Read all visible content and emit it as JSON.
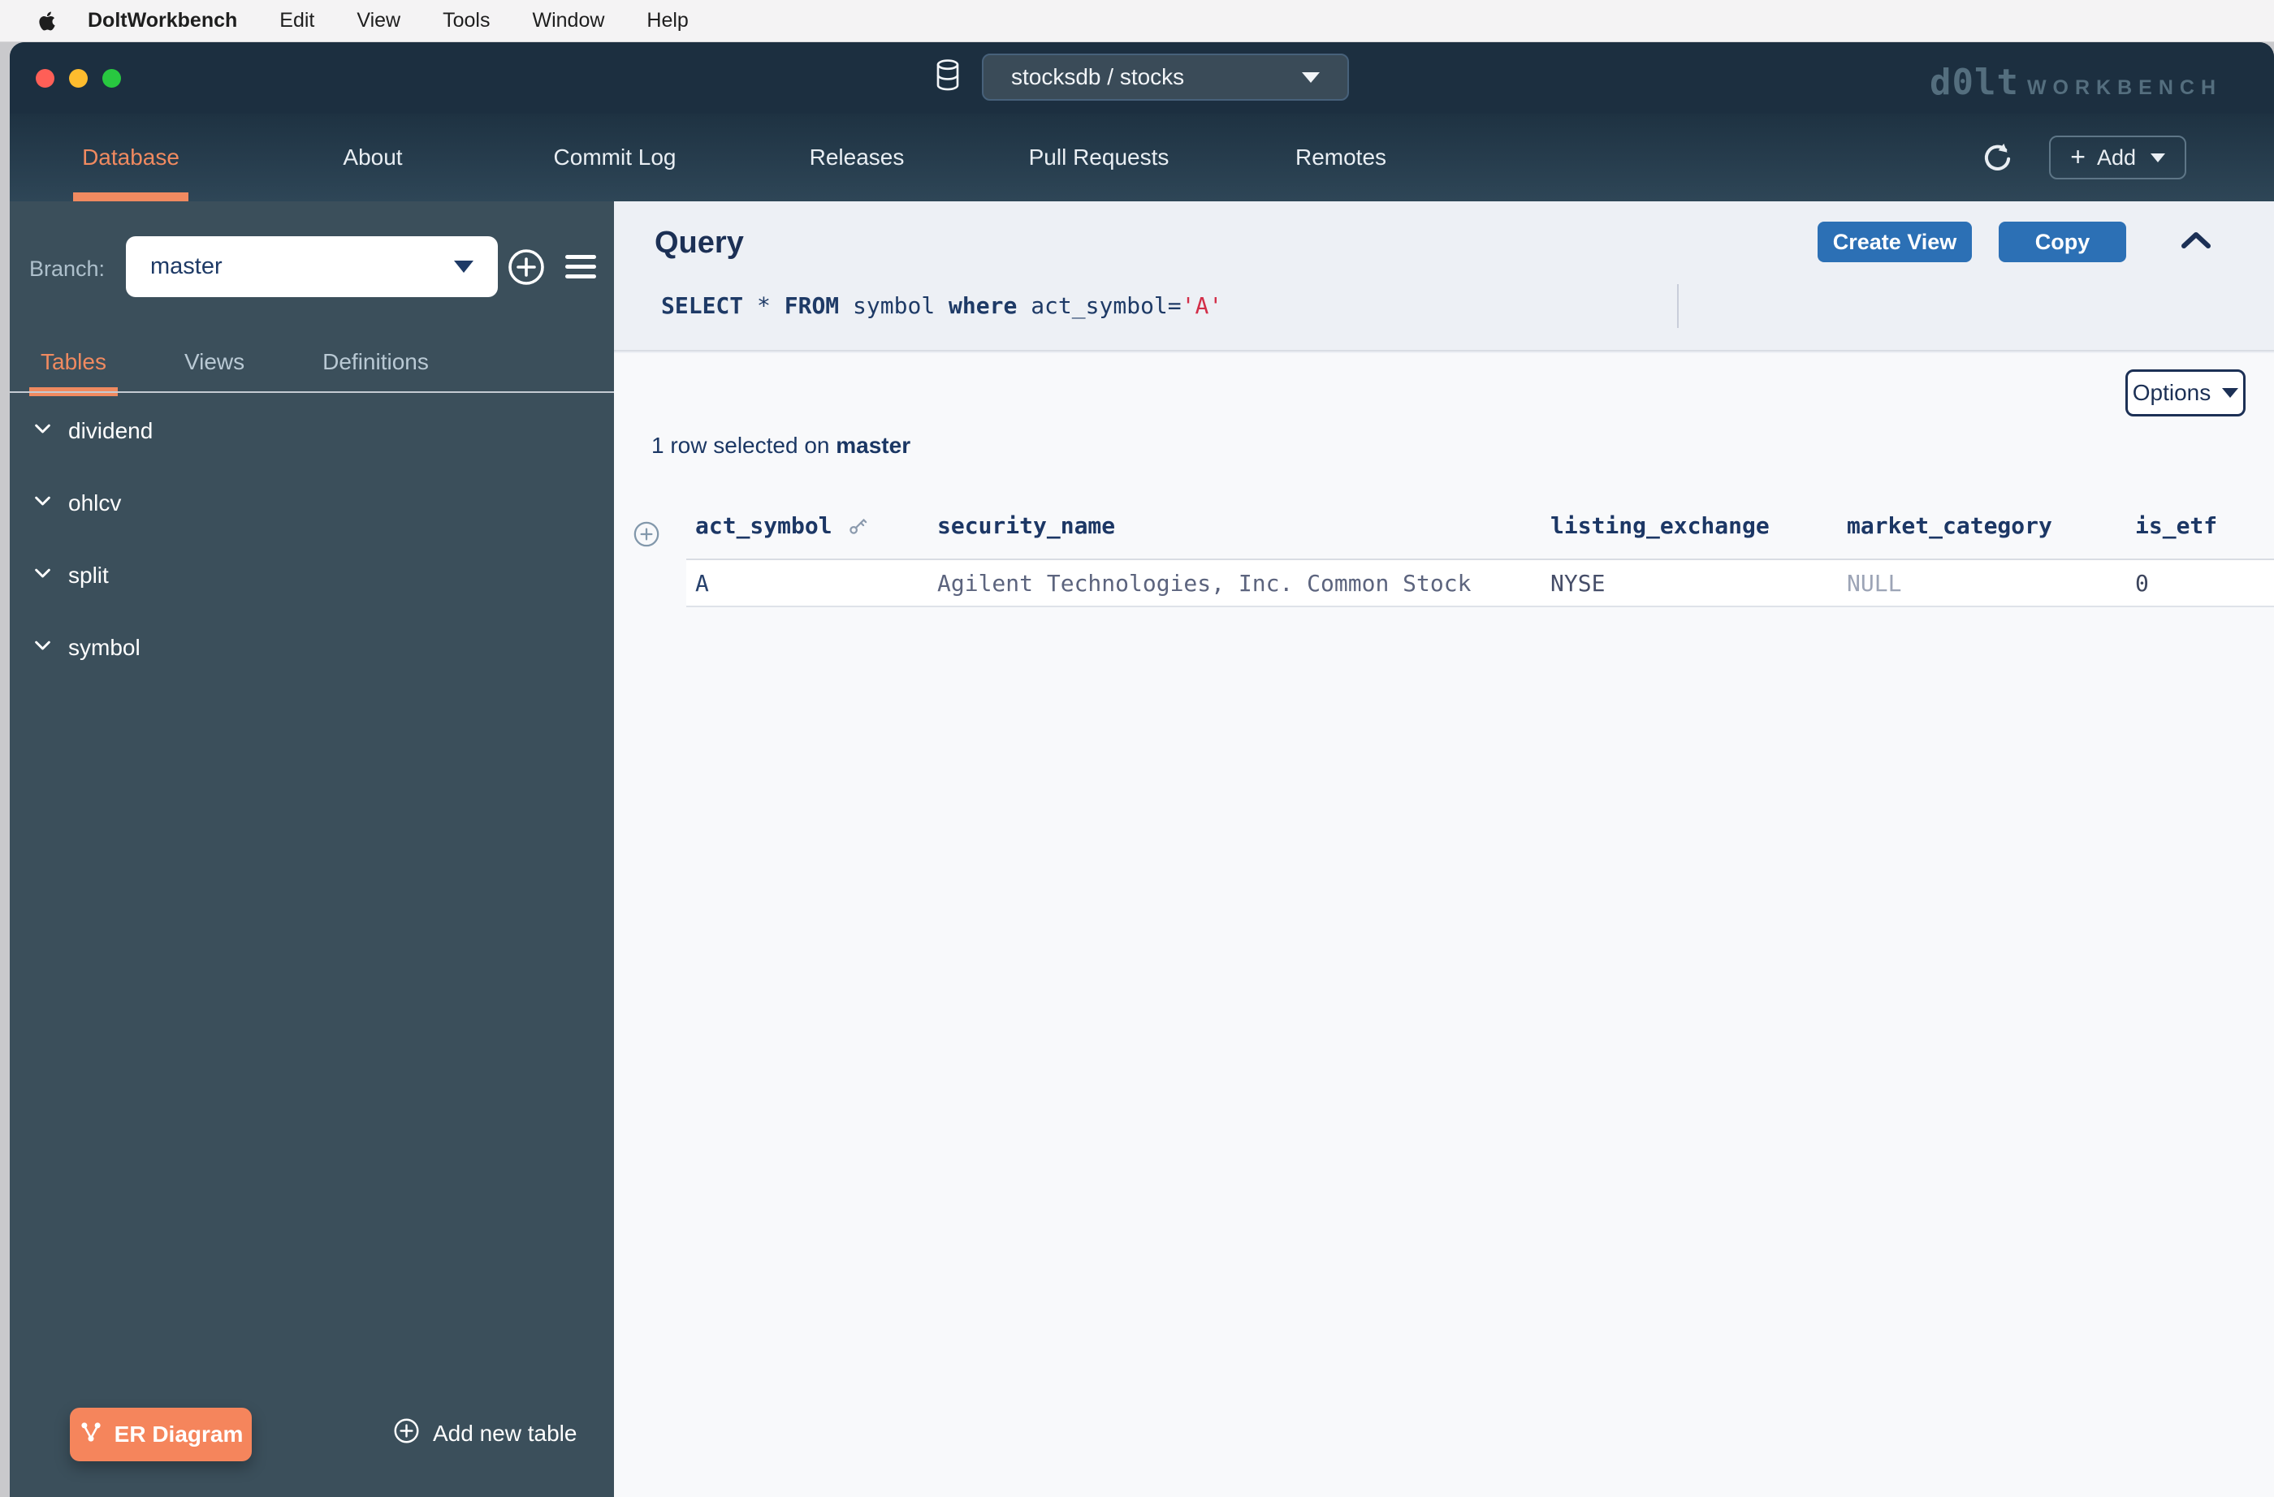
{
  "menubar": {
    "app_name": "DoltWorkbench",
    "items": [
      "Edit",
      "View",
      "Tools",
      "Window",
      "Help"
    ]
  },
  "titlebar": {
    "database_selector": "stocksdb / stocks",
    "logo": {
      "brand": "d0lt",
      "suffix": "WORKBENCH"
    }
  },
  "nav": {
    "items": [
      {
        "label": "Database",
        "active": true
      },
      {
        "label": "About"
      },
      {
        "label": "Commit Log"
      },
      {
        "label": "Releases"
      },
      {
        "label": "Pull Requests"
      },
      {
        "label": "Remotes"
      }
    ],
    "add_button": "Add"
  },
  "sidebar": {
    "branch_label": "Branch:",
    "branch_value": "master",
    "tabs": [
      {
        "label": "Tables",
        "active": true
      },
      {
        "label": "Views"
      },
      {
        "label": "Definitions"
      }
    ],
    "tables": [
      "dividend",
      "ohlcv",
      "split",
      "symbol"
    ],
    "er_diagram_button": "ER Diagram",
    "add_new_table_button": "Add new table"
  },
  "query": {
    "title": "Query",
    "sql": {
      "select": "SELECT ",
      "star": "* ",
      "from": "FROM ",
      "table": "symbol ",
      "where": "where ",
      "condition": "act_symbol=",
      "value": "'A'"
    },
    "create_view_button": "Create View",
    "copy_button": "Copy"
  },
  "results": {
    "options_button": "Options",
    "status": {
      "prefix": "1 row selected on ",
      "branch": "master"
    },
    "table": {
      "columns": [
        "act_symbol",
        "security_name",
        "listing_exchange",
        "market_category",
        "is_etf"
      ],
      "rows": [
        [
          "A",
          "Agilent Technologies, Inc. Common Stock",
          "NYSE",
          "NULL",
          "0"
        ]
      ]
    }
  },
  "colors": {
    "accent_orange": "#f08a60",
    "button_blue": "#2c70b5",
    "navy_text": "#1c3055",
    "sql_string_red": "#d22e48",
    "sidebar_bg": "#3b4f5b",
    "titlebar_bg": "#1c2f40"
  }
}
